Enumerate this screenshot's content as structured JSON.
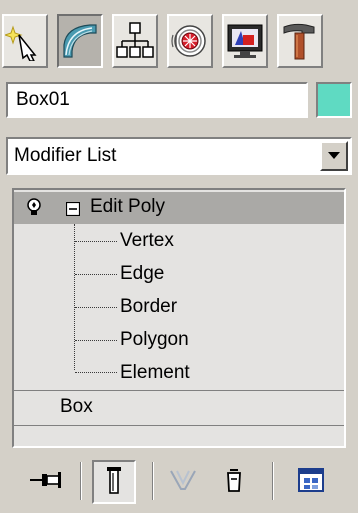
{
  "tabs": [
    {
      "icon": "create-icon",
      "active": false
    },
    {
      "icon": "modify-icon",
      "active": true
    },
    {
      "icon": "hierarchy-icon",
      "active": false
    },
    {
      "icon": "motion-icon",
      "active": false
    },
    {
      "icon": "display-icon",
      "active": false
    },
    {
      "icon": "utilities-icon",
      "active": false
    }
  ],
  "object": {
    "name": "Box01",
    "color": "#5fdac2"
  },
  "modifier_list": {
    "selected": "Modifier List"
  },
  "stack": {
    "modifier": "Edit Poly",
    "subobjects": [
      "Vertex",
      "Edge",
      "Border",
      "Polygon",
      "Element"
    ],
    "base_object": "Box"
  },
  "toolbar": {
    "icons": [
      "pin-stack-icon",
      "show-end-result-icon",
      "make-unique-icon",
      "remove-modifier-icon",
      "configure-modifier-sets-icon"
    ]
  },
  "colors": {
    "panel_bg": "#d4d0c8",
    "stack_bg": "#e4e3e1",
    "selected_row": "#aaa9a6"
  }
}
